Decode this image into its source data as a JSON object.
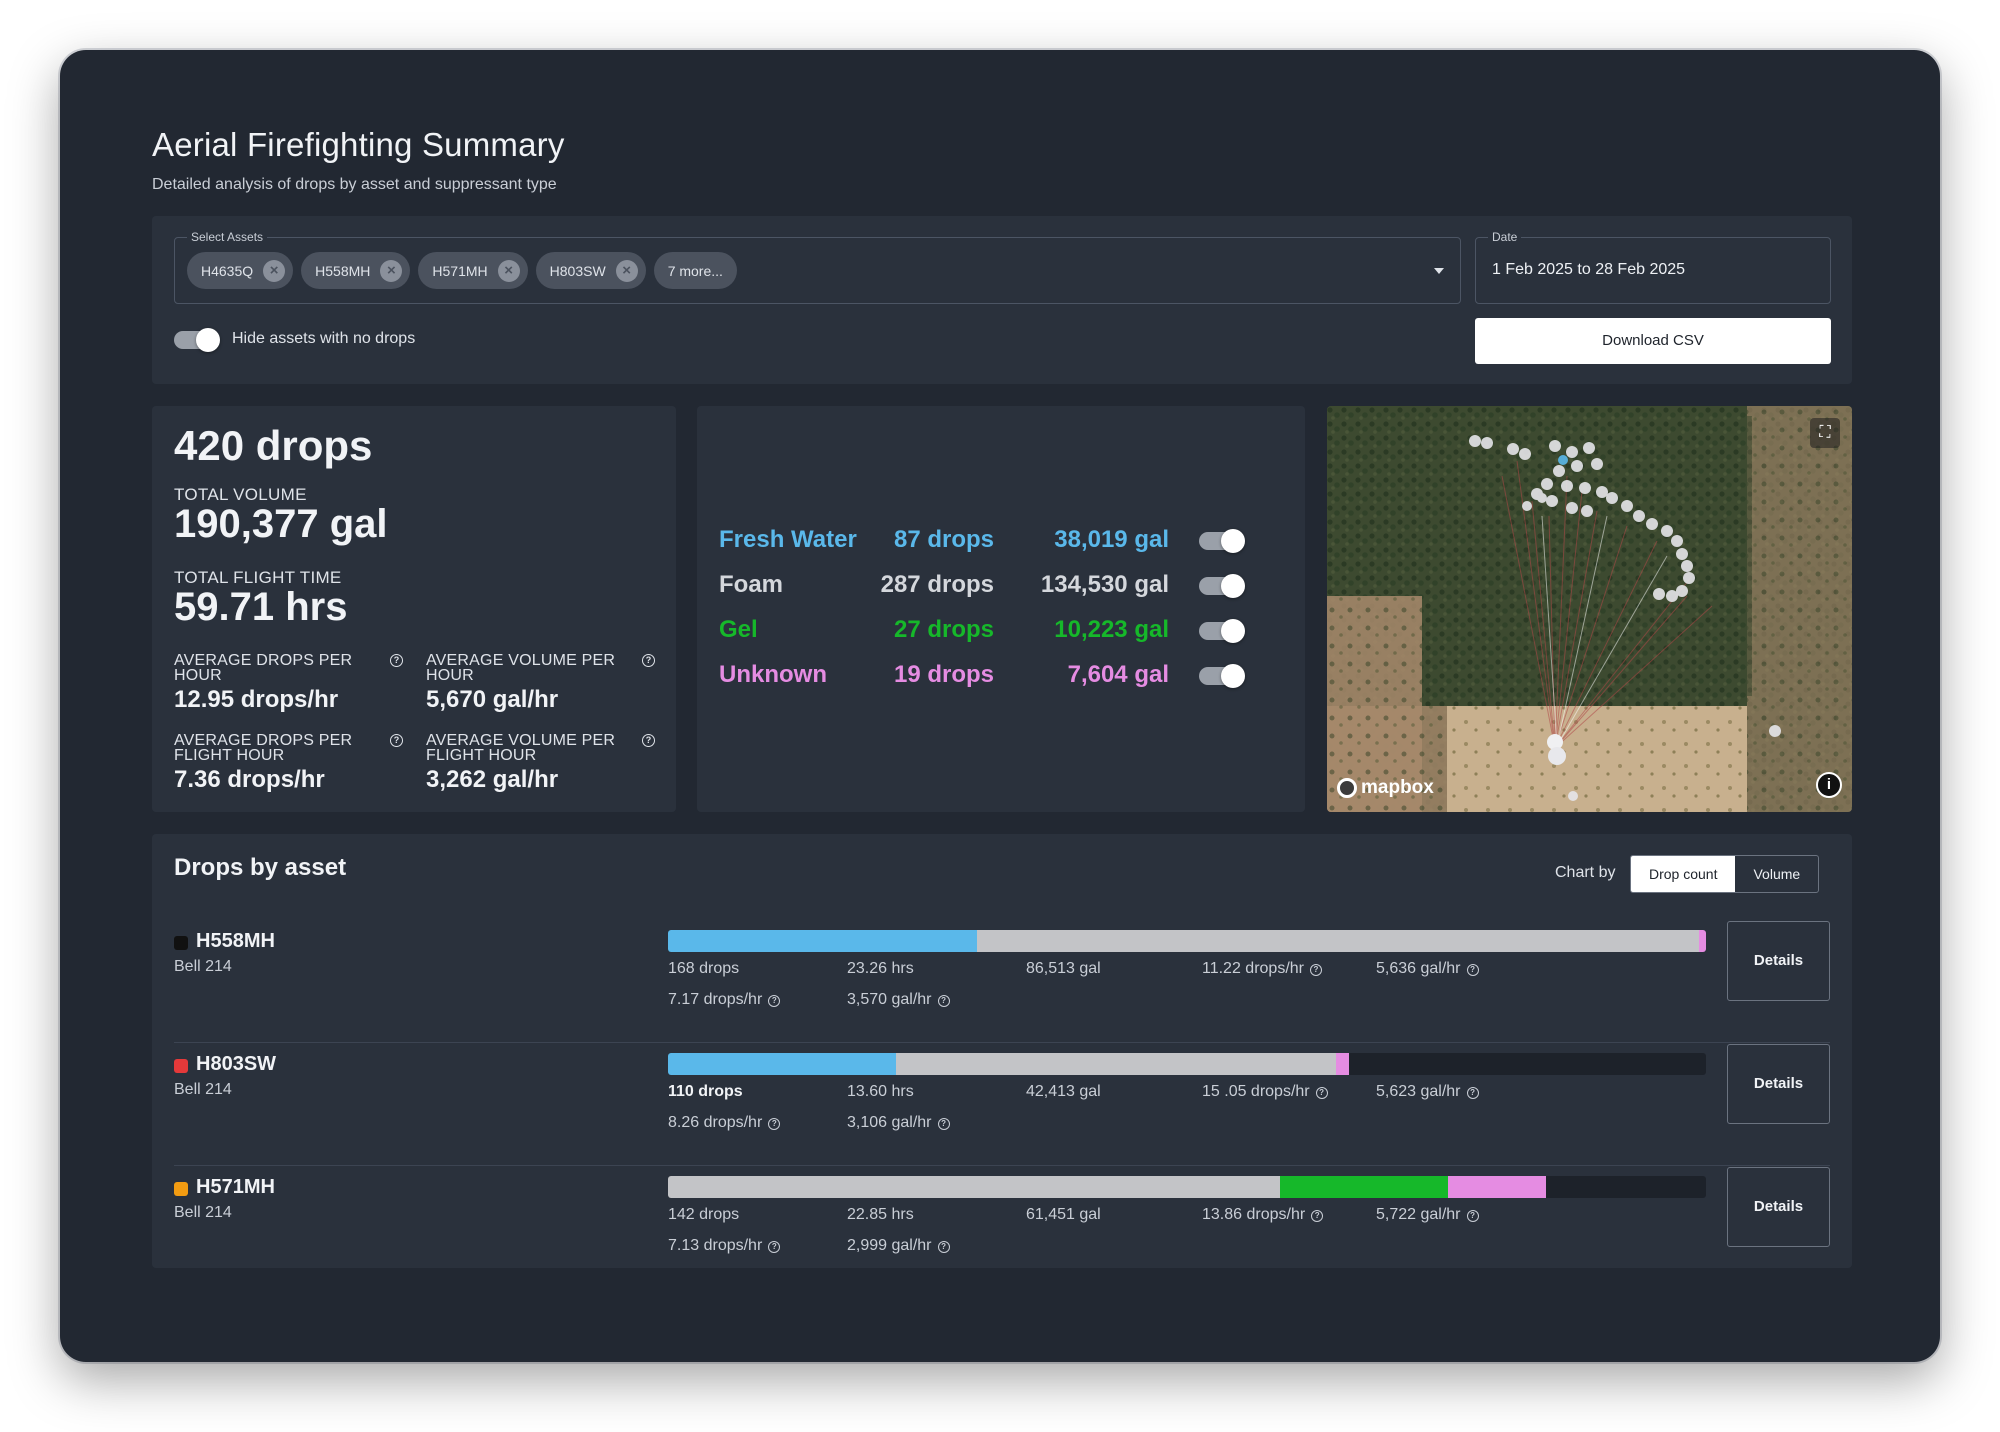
{
  "header": {
    "title": "Aerial Firefighting Summary",
    "subtitle": "Detailed analysis of drops by asset and suppressant type"
  },
  "filters": {
    "assets_label": "Select Assets",
    "selected_assets": [
      "H4635Q",
      "H558MH",
      "H571MH",
      "H803SW"
    ],
    "more_label": "7 more...",
    "date_label": "Date",
    "date_value": "1 Feb 2025 to 28 Feb 2025",
    "hide_toggle_label": "Hide assets with no drops",
    "hide_toggle_on": true,
    "download_label": "Download CSV"
  },
  "totals": {
    "drops": "420 drops",
    "total_volume_label": "TOTAL VOLUME",
    "total_volume": "190,377 gal",
    "flight_time_label": "TOTAL FLIGHT TIME",
    "flight_time": "59.71 hrs",
    "avg_drops_hr_label": "AVERAGE DROPS PER HOUR",
    "avg_drops_hr": "12.95 drops/hr",
    "avg_vol_hr_label": "AVERAGE VOLUME PER HOUR",
    "avg_vol_hr": "5,670 gal/hr",
    "avg_drops_fh_label": "AVERAGE DROPS PER FLIGHT HOUR",
    "avg_drops_fh": "7.36 drops/hr",
    "avg_vol_fh_label": "AVERAGE VOLUME PER FLIGHT HOUR",
    "avg_vol_fh": "3,262 gal/hr"
  },
  "suppressants": [
    {
      "name": "Fresh Water",
      "drops": "87 drops",
      "gal": "38,019 gal",
      "color": "#5ab8ea",
      "on": true
    },
    {
      "name": "Foam",
      "drops": "287 drops",
      "gal": "134,530 gal",
      "color": "#d4d7dc",
      "on": true
    },
    {
      "name": "Gel",
      "drops": "27 drops",
      "gal": "10,223 gal",
      "color": "#16b82a",
      "on": true
    },
    {
      "name": "Unknown",
      "drops": "19 drops",
      "gal": "7,604 gal",
      "color": "#e58ce2",
      "on": true
    }
  ],
  "map": {
    "attribution": "mapbox"
  },
  "drops_by_asset": {
    "heading": "Drops by asset",
    "chart_by_label": "Chart by",
    "chart_by_options": [
      "Drop count",
      "Volume"
    ],
    "chart_by_selected": "Drop count",
    "details_label": "Details",
    "assets": [
      {
        "name": "H558MH",
        "model": "Bell 214",
        "color": "#111111",
        "segments": [
          {
            "type": "Fresh Water",
            "fraction": 0.298,
            "color": "#5ab8ea"
          },
          {
            "type": "Foam",
            "fraction": 0.695,
            "color": "#c3c4c7"
          },
          {
            "type": "Unknown",
            "fraction": 0.007,
            "color": "#e58ce2"
          }
        ],
        "drops": "168 drops",
        "hours": "23.26 hrs",
        "volume": "86,513 gal",
        "drops_per_hr": "11.22 drops/hr",
        "gal_per_hr": "5,636 gal/hr",
        "drops_per_fh": "7.17 drops/hr",
        "gal_per_fh": "3,570 gal/hr"
      },
      {
        "name": "H803SW",
        "model": "Bell 214",
        "color": "#e5393a",
        "segments": [
          {
            "type": "Fresh Water",
            "fraction": 0.22,
            "color": "#5ab8ea"
          },
          {
            "type": "Foam",
            "fraction": 0.424,
            "color": "#c3c4c7"
          },
          {
            "type": "Unknown",
            "fraction": 0.012,
            "color": "#e58ce2"
          }
        ],
        "drops": "110 drops",
        "hours": "13.60 hrs",
        "volume": "42,413 gal",
        "drops_per_hr": "15 .05 drops/hr",
        "gal_per_hr": "5,623 gal/hr",
        "drops_per_fh": "8.26 drops/hr",
        "gal_per_fh": "3,106 gal/hr"
      },
      {
        "name": "H571MH",
        "model": "Bell 214",
        "color": "#f39c12",
        "segments": [
          {
            "type": "Foam",
            "fraction": 0.59,
            "color": "#c3c4c7"
          },
          {
            "type": "Gel",
            "fraction": 0.161,
            "color": "#16b82a"
          },
          {
            "type": "Unknown",
            "fraction": 0.095,
            "color": "#e58ce2"
          }
        ],
        "drops": "142 drops",
        "hours": "22.85 hrs",
        "volume": "61,451 gal",
        "drops_per_hr": "13.86 drops/hr",
        "gal_per_hr": "5,722 gal/hr",
        "drops_per_fh": "7.13 drops/hr",
        "gal_per_fh": "2,999 gal/hr"
      }
    ]
  }
}
